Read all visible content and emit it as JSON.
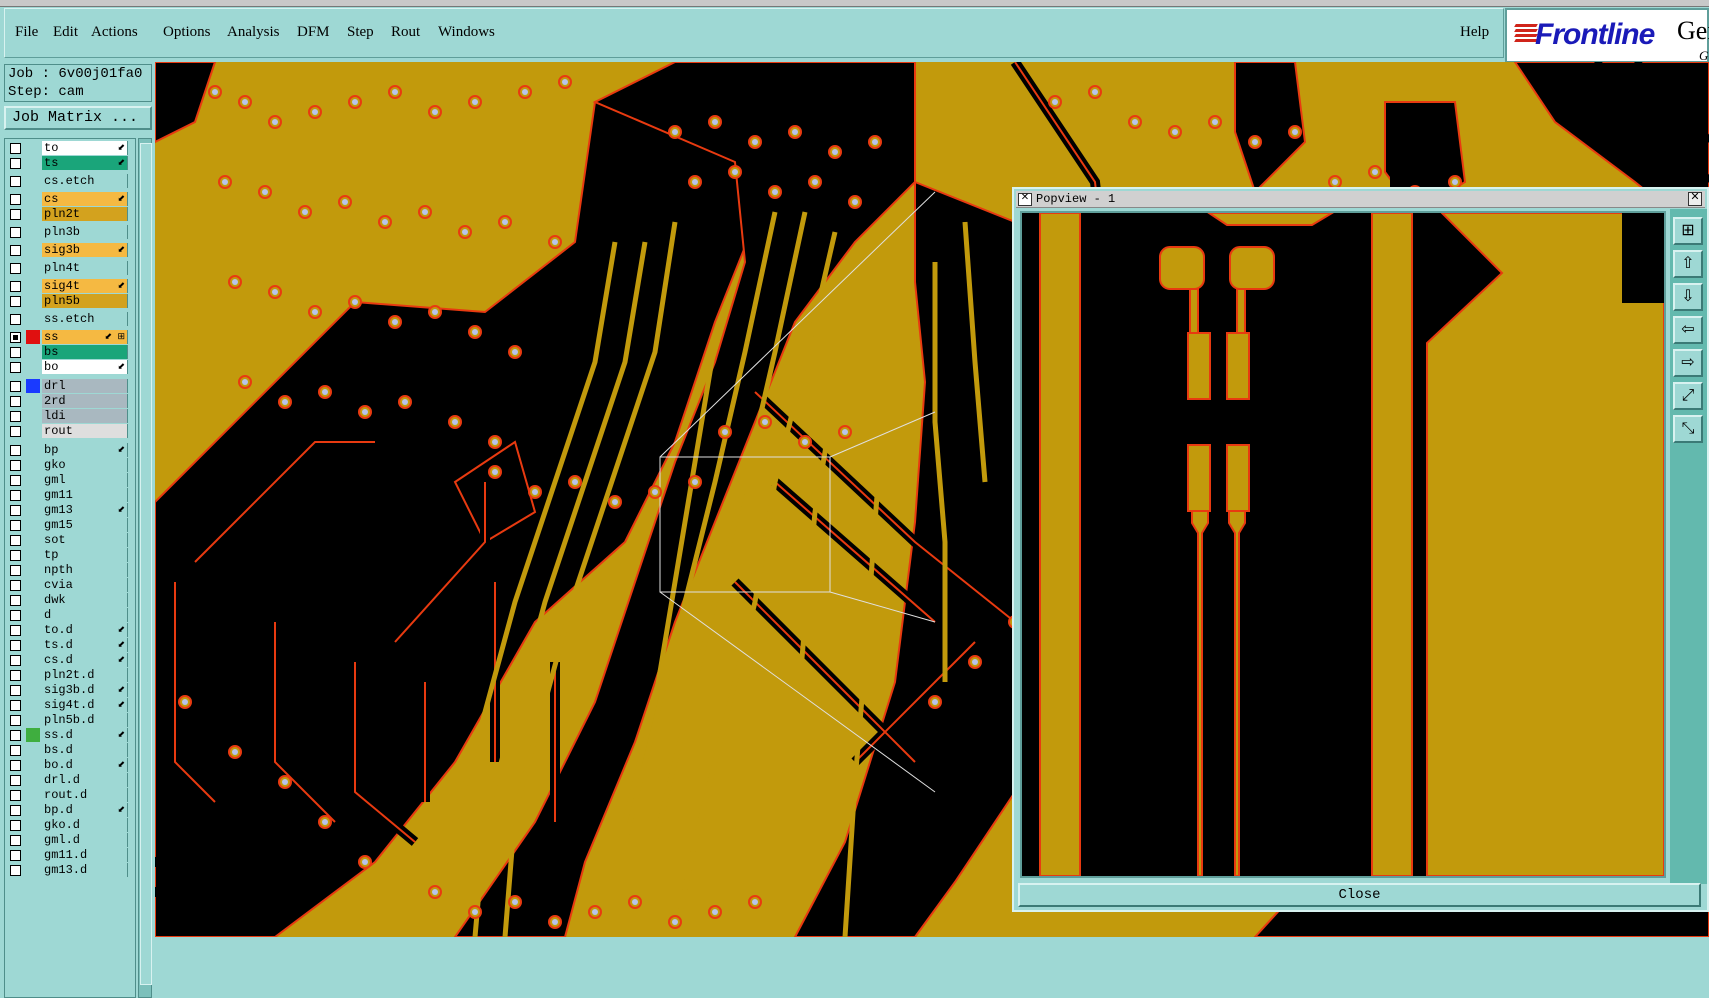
{
  "menu": {
    "items": [
      "File",
      "Edit",
      "Actions",
      "Options",
      "Analysis",
      "DFM",
      "Step",
      "Rout",
      "Windows"
    ],
    "help": "Help"
  },
  "logo": {
    "brand": "Frontline",
    "gen_partial": "Gen",
    "sub_partial": "G"
  },
  "job": {
    "job_line": "Job : 6v00j01fa0",
    "step_line": "Step: cam"
  },
  "job_matrix_button": "Job Matrix ...",
  "layers": [
    {
      "name": "to",
      "color": "#ffffff",
      "marker": "⬋",
      "checked": false,
      "swatch": ""
    },
    {
      "name": "ts",
      "color": "#1aa57a",
      "marker": "⬋",
      "checked": false,
      "swatch": ""
    },
    {
      "name": "cs.etch",
      "color": "#9ed8d4",
      "marker": "",
      "checked": false,
      "swatch": ""
    },
    {
      "name": "cs",
      "color": "#f5b942",
      "marker": "⬋",
      "checked": false,
      "swatch": ""
    },
    {
      "name": "pln2t",
      "color": "#d3a21e",
      "marker": "",
      "checked": false,
      "swatch": ""
    },
    {
      "name": "pln3b",
      "color": "#9ed8d4",
      "marker": "",
      "checked": false,
      "swatch": ""
    },
    {
      "name": "sig3b",
      "color": "#f5b942",
      "marker": "⬋",
      "checked": false,
      "swatch": ""
    },
    {
      "name": "pln4t",
      "color": "#9ed8d4",
      "marker": "",
      "checked": false,
      "swatch": ""
    },
    {
      "name": "sig4t",
      "color": "#f5b942",
      "marker": "⬋",
      "checked": false,
      "swatch": ""
    },
    {
      "name": "pln5b",
      "color": "#d3a21e",
      "marker": "",
      "checked": false,
      "swatch": ""
    },
    {
      "name": "ss.etch",
      "color": "#9ed8d4",
      "marker": "",
      "checked": false,
      "swatch": ""
    },
    {
      "name": "ss",
      "color": "#f5b942",
      "marker": "⬋ ⊞",
      "checked": true,
      "swatch": "#e01010"
    },
    {
      "name": "bs",
      "color": "#1aa57a",
      "marker": "",
      "checked": false,
      "swatch": ""
    },
    {
      "name": "bo",
      "color": "#ffffff",
      "marker": "⬋",
      "checked": false,
      "swatch": ""
    },
    {
      "name": "drl",
      "color": "#a9b8c0",
      "marker": "",
      "checked": false,
      "swatch": "#1a3aff"
    },
    {
      "name": "2rd",
      "color": "#a9b8c0",
      "marker": "",
      "checked": false,
      "swatch": ""
    },
    {
      "name": "ldi",
      "color": "#a9b8c0",
      "marker": "",
      "checked": false,
      "swatch": ""
    },
    {
      "name": "rout",
      "color": "#dedede",
      "marker": "",
      "checked": false,
      "swatch": ""
    },
    {
      "name": "bp",
      "color": "#9ed8d4",
      "marker": "⬋",
      "checked": false,
      "swatch": ""
    },
    {
      "name": "gko",
      "color": "#9ed8d4",
      "marker": "",
      "checked": false,
      "swatch": ""
    },
    {
      "name": "gml",
      "color": "#9ed8d4",
      "marker": "",
      "checked": false,
      "swatch": ""
    },
    {
      "name": "gm11",
      "color": "#9ed8d4",
      "marker": "",
      "checked": false,
      "swatch": ""
    },
    {
      "name": "gm13",
      "color": "#9ed8d4",
      "marker": "⬋",
      "checked": false,
      "swatch": ""
    },
    {
      "name": "gm15",
      "color": "#9ed8d4",
      "marker": "",
      "checked": false,
      "swatch": ""
    },
    {
      "name": "sot",
      "color": "#9ed8d4",
      "marker": "",
      "checked": false,
      "swatch": ""
    },
    {
      "name": "tp",
      "color": "#9ed8d4",
      "marker": "",
      "checked": false,
      "swatch": ""
    },
    {
      "name": "npth",
      "color": "#9ed8d4",
      "marker": "",
      "checked": false,
      "swatch": ""
    },
    {
      "name": "cvia",
      "color": "#9ed8d4",
      "marker": "",
      "checked": false,
      "swatch": ""
    },
    {
      "name": "dwk",
      "color": "#9ed8d4",
      "marker": "",
      "checked": false,
      "swatch": ""
    },
    {
      "name": "d",
      "color": "#9ed8d4",
      "marker": "",
      "checked": false,
      "swatch": ""
    },
    {
      "name": "to.d",
      "color": "#9ed8d4",
      "marker": "⬋",
      "checked": false,
      "swatch": ""
    },
    {
      "name": "ts.d",
      "color": "#9ed8d4",
      "marker": "⬋",
      "checked": false,
      "swatch": ""
    },
    {
      "name": "cs.d",
      "color": "#9ed8d4",
      "marker": "⬋",
      "checked": false,
      "swatch": ""
    },
    {
      "name": "pln2t.d",
      "color": "#9ed8d4",
      "marker": "",
      "checked": false,
      "swatch": ""
    },
    {
      "name": "sig3b.d",
      "color": "#9ed8d4",
      "marker": "⬋",
      "checked": false,
      "swatch": ""
    },
    {
      "name": "sig4t.d",
      "color": "#9ed8d4",
      "marker": "⬋",
      "checked": false,
      "swatch": ""
    },
    {
      "name": "pln5b.d",
      "color": "#9ed8d4",
      "marker": "",
      "checked": false,
      "swatch": ""
    },
    {
      "name": "ss.d",
      "color": "#9ed8d4",
      "marker": "⬋",
      "checked": false,
      "swatch": "#3fae3f"
    },
    {
      "name": "bs.d",
      "color": "#9ed8d4",
      "marker": "",
      "checked": false,
      "swatch": ""
    },
    {
      "name": "bo.d",
      "color": "#9ed8d4",
      "marker": "⬋",
      "checked": false,
      "swatch": ""
    },
    {
      "name": "drl.d",
      "color": "#9ed8d4",
      "marker": "",
      "checked": false,
      "swatch": ""
    },
    {
      "name": "rout.d",
      "color": "#9ed8d4",
      "marker": "",
      "checked": false,
      "swatch": ""
    },
    {
      "name": "bp.d",
      "color": "#9ed8d4",
      "marker": "⬋",
      "checked": false,
      "swatch": ""
    },
    {
      "name": "gko.d",
      "color": "#9ed8d4",
      "marker": "",
      "checked": false,
      "swatch": ""
    },
    {
      "name": "gml.d",
      "color": "#9ed8d4",
      "marker": "",
      "checked": false,
      "swatch": ""
    },
    {
      "name": "gm11.d",
      "color": "#9ed8d4",
      "marker": "",
      "checked": false,
      "swatch": ""
    },
    {
      "name": "gm13.d",
      "color": "#9ed8d4",
      "marker": "",
      "checked": false,
      "swatch": ""
    }
  ],
  "popview": {
    "title": "Popview - 1",
    "close_label": "Close",
    "tools": [
      "zoom-fit-icon",
      "pan-up-icon",
      "pan-down-icon",
      "pan-left-icon",
      "pan-right-icon",
      "zoom-in-icon",
      "zoom-out-icon"
    ]
  },
  "colors": {
    "copper": "#c29a0c",
    "outline": "#e83a10",
    "background": "#000000",
    "panel": "#9ed8d4"
  }
}
